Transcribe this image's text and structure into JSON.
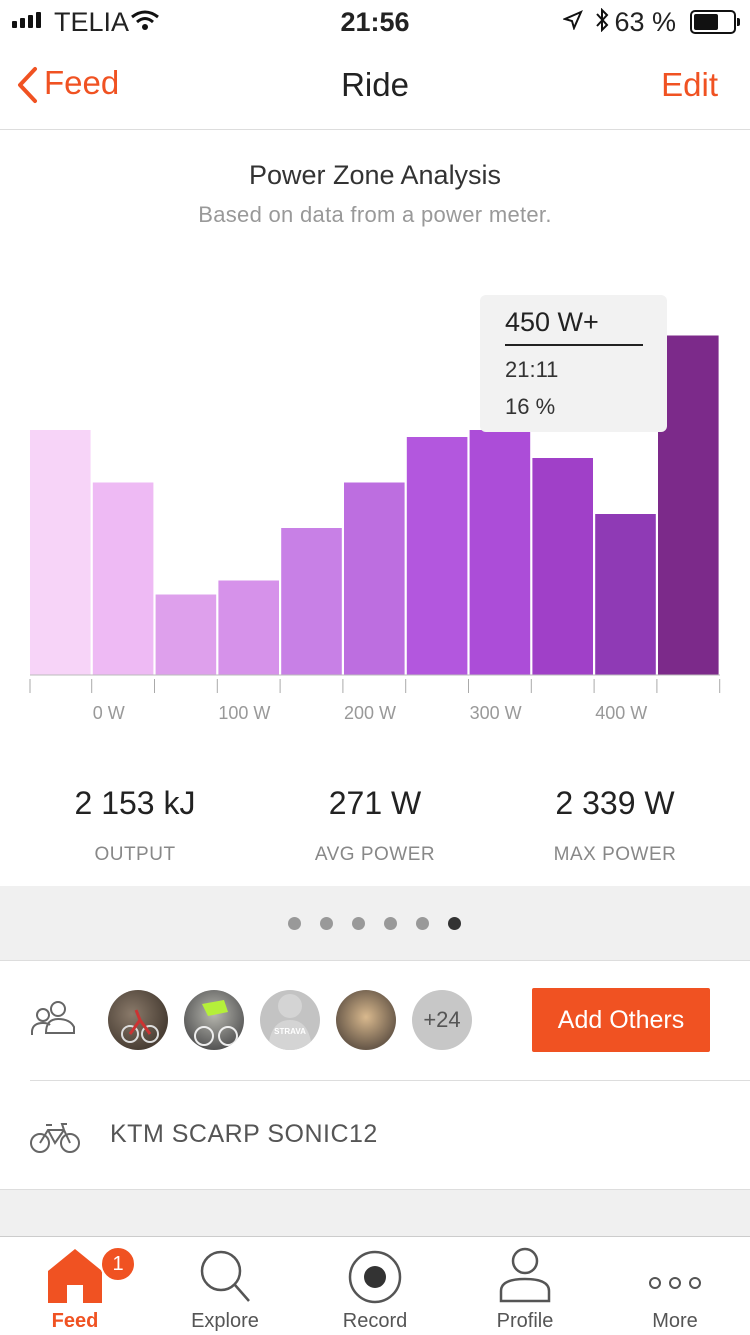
{
  "status_bar": {
    "carrier": "TELIA",
    "time": "21:56",
    "battery": "63 %",
    "battery_level": 0.63
  },
  "nav": {
    "back_label": "Feed",
    "title": "Ride",
    "edit_label": "Edit"
  },
  "chart_header": {
    "title": "Power Zone Analysis",
    "subtitle": "Based on data from a power meter."
  },
  "chart_data": {
    "type": "bar",
    "title": "Power Zone Analysis",
    "tick_labels": [
      "0 W",
      "100 W",
      "200 W",
      "300 W",
      "400 W"
    ],
    "bins": [
      "<0 W",
      "0–50 W",
      "50–100 W",
      "100–150 W",
      "150–200 W",
      "200–250 W",
      "250–300 W",
      "300–350 W",
      "350–400 W",
      "400–450 W",
      "450 W+"
    ],
    "values": [
      7.0,
      5.5,
      2.3,
      2.7,
      4.2,
      5.5,
      6.8,
      7.0,
      6.2,
      4.6,
      9.7
    ],
    "colors": [
      "#f7d4f8",
      "#eebaf4",
      "#dea0ec",
      "#d692ea",
      "#c880e6",
      "#bd6ee0",
      "#b357de",
      "#ac4dd8",
      "#a040c8",
      "#8f3ab5",
      "#7c2a8a"
    ],
    "ylim": [
      0,
      11
    ],
    "tooltip": {
      "label": "450 W+",
      "time": "21:11",
      "percent": "16 %"
    }
  },
  "stats": [
    {
      "value": "2 153 kJ",
      "label": "OUTPUT"
    },
    {
      "value": "271 W",
      "label": "AVG POWER"
    },
    {
      "value": "2 339 W",
      "label": "MAX POWER"
    }
  ],
  "pager": {
    "count": 6,
    "active": 5
  },
  "athletes": {
    "more_count": "+24",
    "add_label": "Add Others"
  },
  "gear": {
    "bike_name": "KTM SCARP SONIC12"
  },
  "tabs": [
    {
      "label": "Feed",
      "icon": "home-icon",
      "badge": "1"
    },
    {
      "label": "Explore",
      "icon": "search-icon"
    },
    {
      "label": "Record",
      "icon": "record-icon"
    },
    {
      "label": "Profile",
      "icon": "profile-icon"
    },
    {
      "label": "More",
      "icon": "more-icon"
    }
  ],
  "accent": "#f05222"
}
